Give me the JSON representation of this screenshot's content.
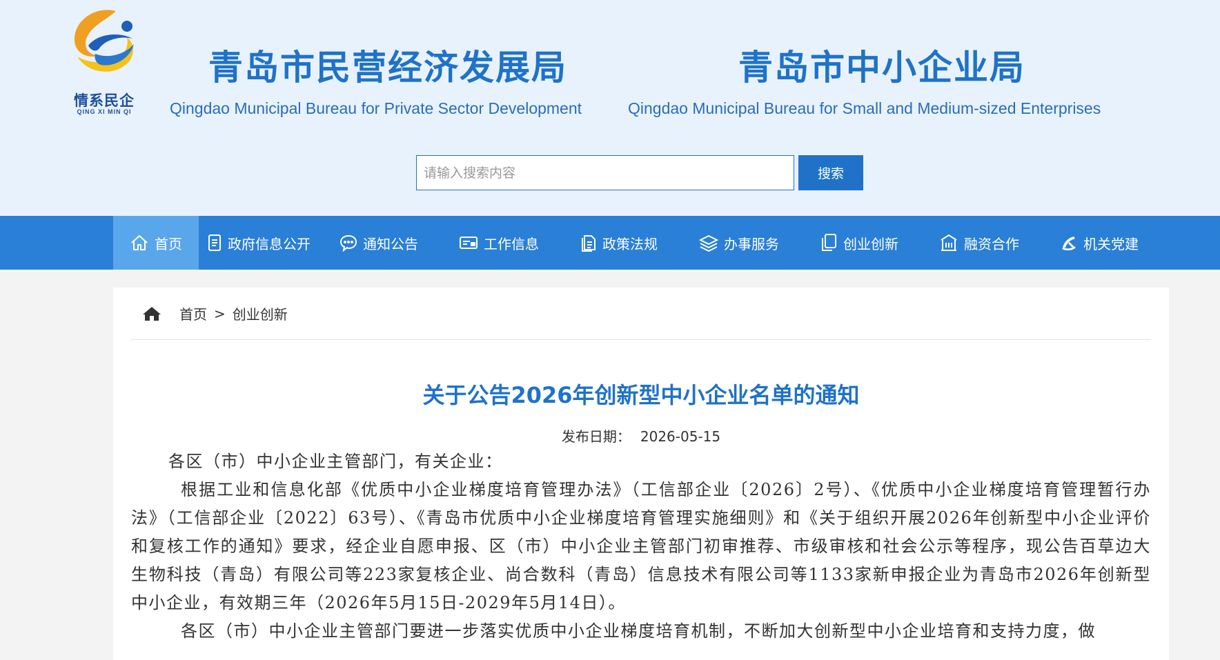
{
  "logo": {
    "icon": "qingxi-minqi-logo",
    "text_cn": "情系民企",
    "text_en": "QING XI MIN QI"
  },
  "header": {
    "org1_cn": "青岛市民营经济发展局",
    "org1_en": "Qingdao Municipal Bureau for Private Sector Development",
    "org2_cn": "青岛市中小企业局",
    "org2_en": "Qingdao Municipal Bureau for Small and Medium-sized Enterprises"
  },
  "search": {
    "placeholder": "请输入搜索内容",
    "button_label": "搜索"
  },
  "nav": {
    "items": [
      {
        "label": "首页",
        "icon": "home-icon"
      },
      {
        "label": "政府信息公开",
        "icon": "document-icon"
      },
      {
        "label": "通知公告",
        "icon": "chat-bubble-icon"
      },
      {
        "label": "工作信息",
        "icon": "monitor-icon"
      },
      {
        "label": "政策法规",
        "icon": "file-stack-icon"
      },
      {
        "label": "办事服务",
        "icon": "layers-icon"
      },
      {
        "label": "创业创新",
        "icon": "copy-icon"
      },
      {
        "label": "融资合作",
        "icon": "building-icon"
      },
      {
        "label": "机关党建",
        "icon": "party-emblem-icon"
      }
    ]
  },
  "breadcrumb": {
    "home": "首页",
    "separator": ">",
    "current": "创业创新"
  },
  "article": {
    "title": "关于公告2026年创新型中小企业名单的通知",
    "date_label": "发布日期：",
    "date_value": "2026-05-15",
    "salutation": "各区（市）中小企业主管部门，有关企业：",
    "paragraph1": "根据工业和信息化部《优质中小企业梯度培育管理办法》（工信部企业〔2026〕2号）、《优质中小企业梯度培育管理暂行办法》（工信部企业〔2022〕63号）、《青岛市优质中小企业梯度培育管理实施细则》和《关于组织开展2026年创新型中小企业评价和复核工作的通知》要求，经企业自愿申报、区（市）中小企业主管部门初审推荐、市级审核和社会公示等程序，现公告百草边大生物科技（青岛）有限公司等223家复核企业、尚合数科（青岛）信息技术有限公司等1133家新申报企业为青岛市2026年创新型中小企业，有效期三年（2026年5月15日-2029年5月14日）。",
    "paragraph2": "各区（市）中小企业主管部门要进一步落实优质中小企业梯度培育机制，不断加大创新型中小企业培育和支持力度，做"
  },
  "colors": {
    "header_bg": "#e8f2fc",
    "brand_blue": "#1f72c8",
    "nav_bg": "#2a7fd6",
    "nav_active": "#5aa6ea"
  }
}
